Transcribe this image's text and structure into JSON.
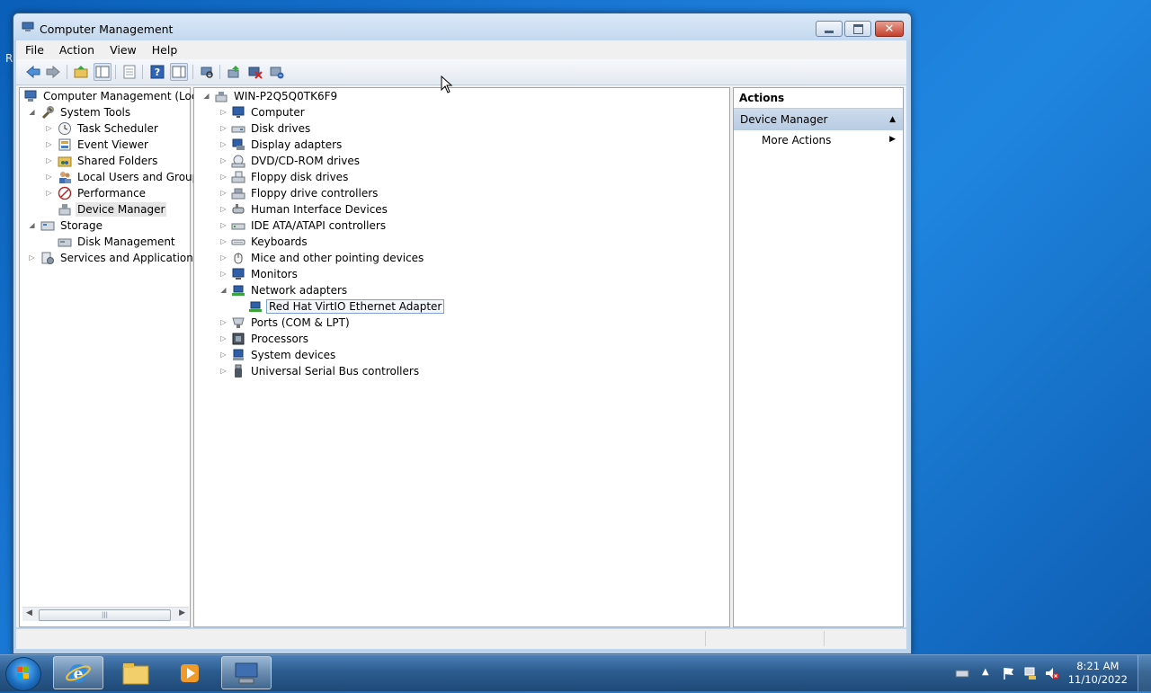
{
  "desktop": {
    "edge_letter": "R"
  },
  "window": {
    "title": "Computer Management"
  },
  "menu": [
    "File",
    "Action",
    "View",
    "Help"
  ],
  "toolbar_icons": [
    "back-icon",
    "forward-icon",
    "up-folder-icon",
    "show-tree-icon",
    "properties-icon",
    "help-icon",
    "show-action-pane-icon",
    "scan-hardware-icon",
    "update-driver-icon",
    "disable-device-icon",
    "uninstall-device-icon"
  ],
  "left_tree": {
    "root": "Computer Management (Local",
    "system_tools": "System Tools",
    "task_scheduler": "Task Scheduler",
    "event_viewer": "Event Viewer",
    "shared_folders": "Shared Folders",
    "local_users": "Local Users and Groups",
    "performance": "Performance",
    "device_manager": "Device Manager",
    "storage": "Storage",
    "disk_management": "Disk Management",
    "services": "Services and Applications"
  },
  "device_tree": {
    "host": "WIN-P2Q5Q0TK6F9",
    "categories": [
      "Computer",
      "Disk drives",
      "Display adapters",
      "DVD/CD-ROM drives",
      "Floppy disk drives",
      "Floppy drive controllers",
      "Human Interface Devices",
      "IDE ATA/ATAPI controllers",
      "Keyboards",
      "Mice and other pointing devices",
      "Monitors",
      "Network adapters"
    ],
    "network_child": "Red Hat VirtIO Ethernet Adapter",
    "after": [
      "Ports (COM & LPT)",
      "Processors",
      "System devices",
      "Universal Serial Bus controllers"
    ]
  },
  "actions": {
    "header": "Actions",
    "section": "Device Manager",
    "item": "More Actions"
  },
  "taskbar": {
    "time": "8:21 AM",
    "date": "11/10/2022"
  },
  "colors": {
    "selection_border": "#7da2ce",
    "actions_section_bg": "#c4d5ea"
  }
}
